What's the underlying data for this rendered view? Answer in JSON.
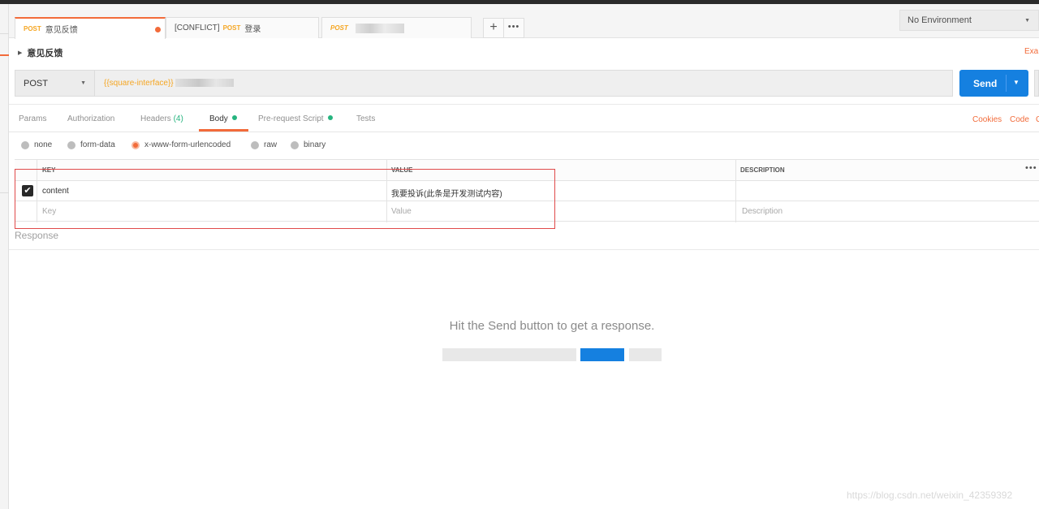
{
  "tabs": [
    {
      "method": "POST",
      "label": "意见反馈",
      "unsaved": true,
      "active": true
    },
    {
      "prefix": "[CONFLICT]",
      "method": "POST",
      "label": "登录",
      "active": false
    },
    {
      "method": "POST",
      "label": "",
      "blurred": true,
      "active": false
    }
  ],
  "environment": {
    "selected": "No Environment"
  },
  "request": {
    "name": "意见反馈",
    "examples_label": "Exa"
  },
  "url_bar": {
    "method": "POST",
    "url": "{{square-interface}}",
    "send_label": "Send"
  },
  "subtabs": {
    "params": "Params",
    "authorization": "Authorization",
    "headers": "Headers",
    "headers_count": "(4)",
    "body": "Body",
    "prerequest": "Pre-request Script",
    "tests": "Tests",
    "cookies": "Cookies",
    "code": "Code",
    "cut": "C"
  },
  "body_types": {
    "none": "none",
    "form_data": "form-data",
    "urlencoded": "x-www-form-urlencoded",
    "raw": "raw",
    "binary": "binary",
    "selected": "x-www-form-urlencoded"
  },
  "kv_table": {
    "headers": {
      "key": "KEY",
      "value": "VALUE",
      "description": "DESCRIPTION"
    },
    "rows": [
      {
        "checked": true,
        "key": "content",
        "value": "我要投诉(此条是开发测试内容)",
        "description": ""
      }
    ],
    "placeholder": {
      "key": "Key",
      "value": "Value",
      "description": "Description"
    }
  },
  "response": {
    "label": "Response",
    "hint": "Hit the Send button to get a response."
  },
  "watermark": "https://blog.csdn.net/weixin_42359392",
  "colors": {
    "accent": "#f26b3a",
    "send_blue": "#1580e0",
    "active_green": "#26b47f",
    "method_orange": "#f5a623"
  }
}
